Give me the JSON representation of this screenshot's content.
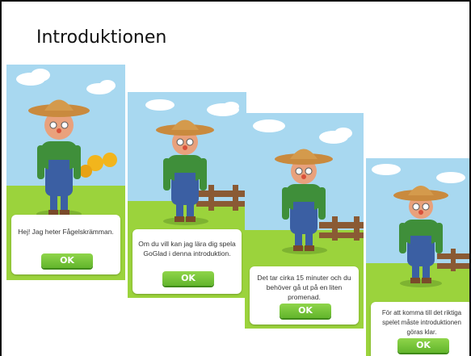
{
  "title": "Introduktionen",
  "cards": [
    {
      "message": "Hej! Jag heter Fågelskrämman.",
      "ok_label": "OK"
    },
    {
      "message": "Om du vill kan jag lära dig spela GoGlad i denna introduktion.",
      "ok_label": "OK"
    },
    {
      "message": "Det tar cirka 15 minuter och du behöver gå ut på en liten promenad.",
      "ok_label": "OK"
    },
    {
      "message": "För att komma till det riktiga spelet måste introduktionen göras klar.",
      "ok_label": "OK"
    }
  ],
  "icons": [
    "scarecrow-illustration",
    "cloud-icon",
    "sunflower-icon",
    "fence-icon"
  ],
  "colors": {
    "sky": "#a8d8f0",
    "grass": "#9bd33c",
    "ok_button": "#6cc03a",
    "panel": "#ffffff"
  }
}
